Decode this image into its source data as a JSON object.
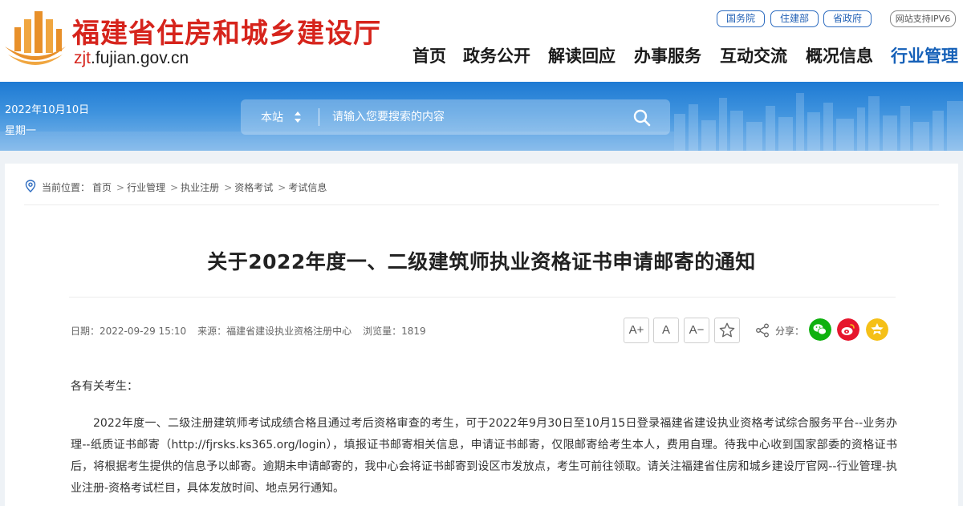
{
  "site": {
    "name_cn": "福建省住房和城乡建设厅",
    "domain_prefix": "zjt",
    "domain_rest": ".fujian.gov.cn",
    "colors": {
      "brand_red": "#d6241c",
      "brand_blue": "#1560b8",
      "emblem_orange": "#e8902a"
    }
  },
  "top_links": [
    {
      "label": "国务院"
    },
    {
      "label": "住建部"
    },
    {
      "label": "省政府"
    }
  ],
  "ipv6_badge": "网站支持IPV6",
  "nav": [
    {
      "label": "首页"
    },
    {
      "label": "政务公开"
    },
    {
      "label": "解读回应"
    },
    {
      "label": "办事服务"
    },
    {
      "label": "互动交流"
    },
    {
      "label": "概况信息"
    },
    {
      "label": "行业管理",
      "active": true
    }
  ],
  "banner": {
    "date": "2022年10月10日",
    "weekday": "星期一"
  },
  "search": {
    "scope": "本站",
    "placeholder": "请输入您要搜索的内容",
    "icons": {
      "scope_toggle": "updown-arrows-icon",
      "submit": "search-icon"
    }
  },
  "breadcrumb": {
    "label": "当前位置：",
    "items": [
      "首页",
      "行业管理",
      "执业注册",
      "资格考试",
      "考试信息"
    ],
    "separator": ">"
  },
  "article": {
    "title": "关于2022年度一、二级建筑师执业资格证书申请邮寄的通知",
    "meta": {
      "date": "日期：2022-09-29 15:10",
      "source": "来源：福建省建设执业资格注册中心",
      "views": "浏览量：1819"
    },
    "tools": {
      "font_larger": "A+",
      "font_normal": "A",
      "font_smaller": "A−",
      "favorite_icon": "star-outline-icon"
    },
    "share": {
      "label": "分享：",
      "icons": [
        "wechat-icon",
        "weibo-icon",
        "qzone-icon"
      ],
      "colors": {
        "wechat": "#0fb10f",
        "weibo": "#e6162d",
        "qzone": "#f5c018"
      }
    },
    "salutation": "各有关考生：",
    "body": "2022年度一、二级注册建筑师考试成绩合格且通过考后资格审查的考生，可于2022年9月30日至10月15日登录福建省建设执业资格考试综合服务平台--业务办理--纸质证书邮寄（http://fjrsks.ks365.org/login），填报证书邮寄相关信息，申请证书邮寄，仅限邮寄给考生本人，费用自理。待我中心收到国家部委的资格证书后，将根据考生提供的信息予以邮寄。逾期未申请邮寄的，我中心会将证书邮寄到设区市发放点，考生可前往领取。请关注福建省住房和城乡建设厅官网--行业管理-执业注册-资格考试栏目，具体发放时间、地点另行通知。"
  }
}
